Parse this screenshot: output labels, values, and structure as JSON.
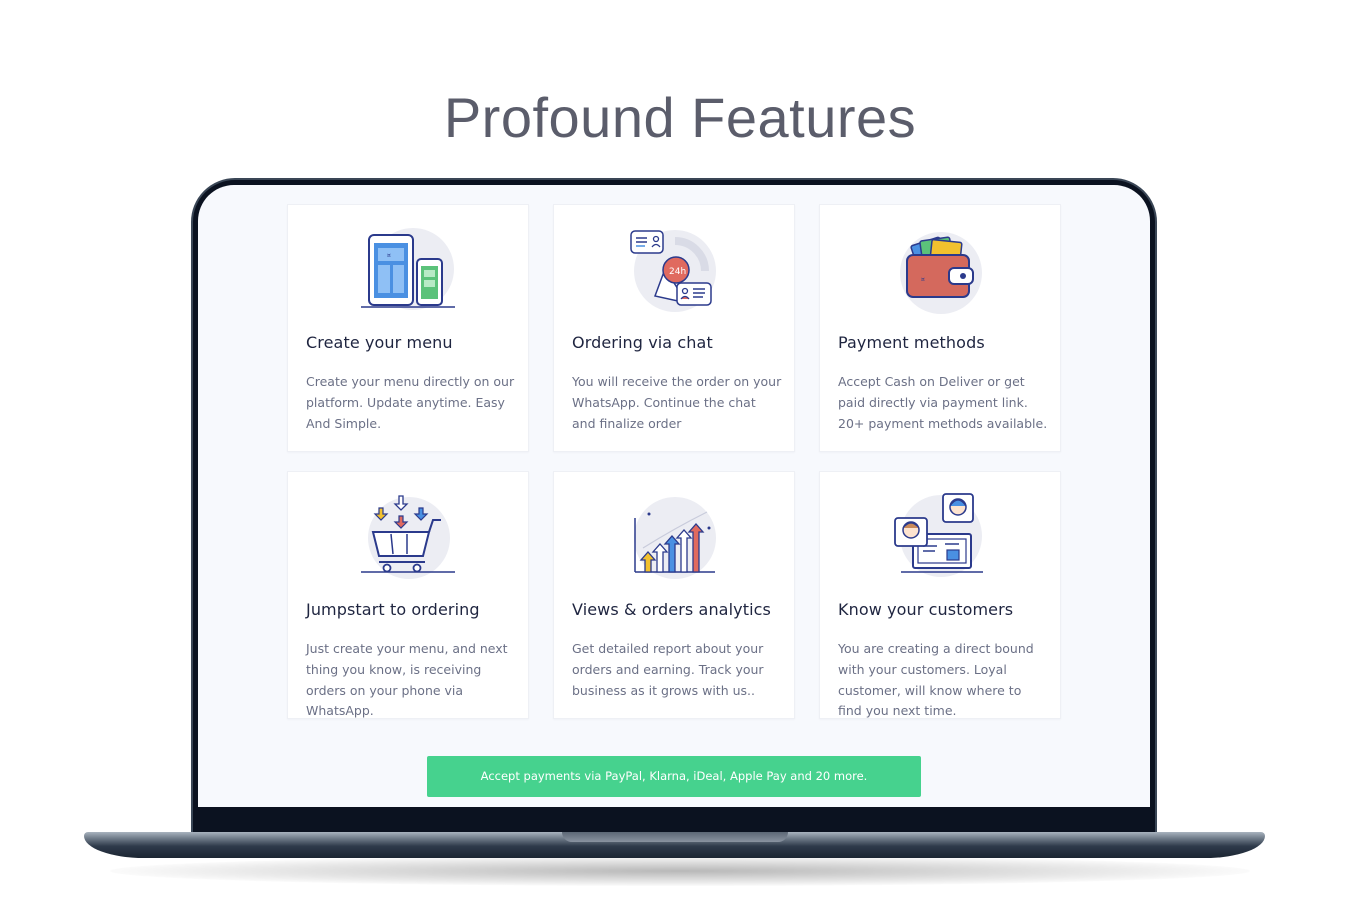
{
  "page": {
    "title": "Profound Features"
  },
  "features": [
    {
      "title": "Create your menu",
      "description": "Create your menu directly on our platform. Update anytime. Easy And Simple.",
      "icon": "phone-tablet-menu-icon"
    },
    {
      "title": "Ordering via chat",
      "description": "You will receive the order on your WhatsApp. Continue the chat and finalize order",
      "icon": "chat-24h-icon",
      "icon_label": "24h"
    },
    {
      "title": "Payment methods",
      "description": "Accept Cash on Deliver or get paid directly via payment link. 20+ payment methods available.",
      "icon": "wallet-icon"
    },
    {
      "title": "Jumpstart to ordering",
      "description": "Just create your menu, and next thing you know, is receiving orders on your phone via WhatsApp.",
      "icon": "shopping-cart-icon"
    },
    {
      "title": "Views & orders analytics",
      "description": "Get detailed report about your orders and earning. Track your business as it grows with us..",
      "icon": "analytics-arrows-icon"
    },
    {
      "title": "Know your customers",
      "description": "You are creating a direct bound with your customers. Loyal customer, will know where to find you next time.",
      "icon": "customers-profiles-icon"
    }
  ],
  "cta": {
    "label": "Accept payments via PayPal, Klarna, iDeal, Apple Pay and 20 more."
  },
  "colors": {
    "accent_green": "#46d28e",
    "title_gray": "#5b5d6b",
    "card_title": "#1f2540",
    "card_text": "#6b7086",
    "screen_bg": "#f7f9fd",
    "illustration_blue": "#4a90e2",
    "illustration_navy": "#2b3a8c",
    "illustration_red": "#e06a5f",
    "illustration_green": "#5bc27a",
    "illustration_yellow": "#f2c12e"
  }
}
